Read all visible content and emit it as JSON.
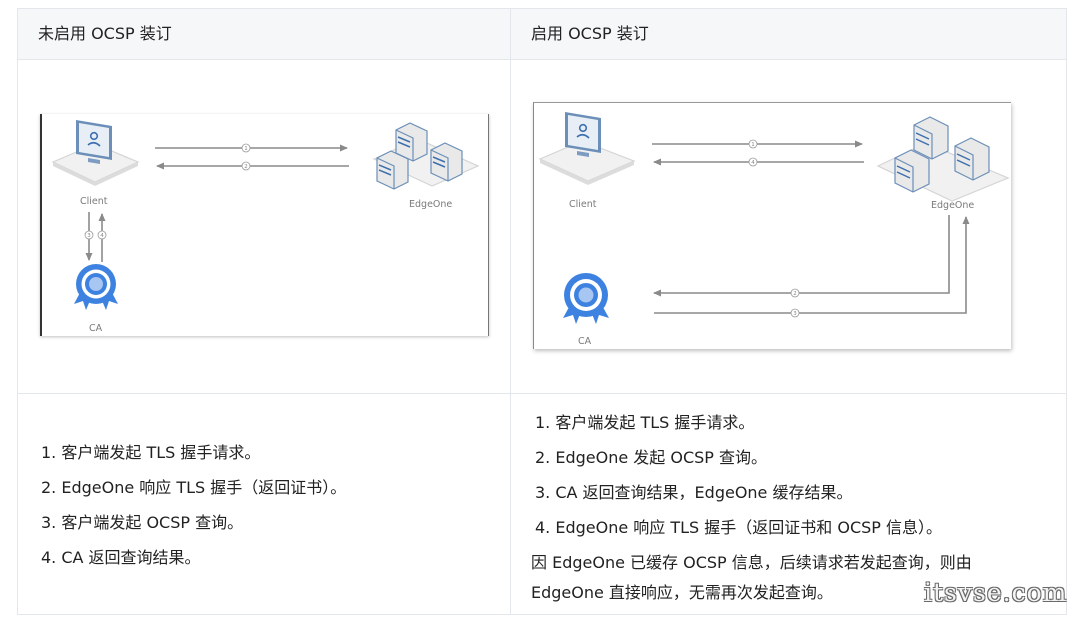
{
  "table": {
    "left_header": "未启用 OCSP 装订",
    "right_header": "启用 OCSP 装订"
  },
  "left_diagram": {
    "client_label": "Client",
    "edgeone_label": "EdgeOne",
    "ca_label": "CA",
    "arrows": [
      "1",
      "2",
      "3",
      "4"
    ]
  },
  "right_diagram": {
    "client_label": "Client",
    "edgeone_label": "EdgeOne",
    "ca_label": "CA",
    "arrows": [
      "1",
      "4",
      "2",
      "3"
    ]
  },
  "left_steps": [
    "1.  客户端发起 TLS 握手请求。",
    "2.  EdgeOne 响应 TLS 握手（返回证书）。",
    "3.  客户端发起 OCSP 查询。",
    "4.  CA 返回查询结果。"
  ],
  "right_steps": [
    "1.  客户端发起 TLS 握手请求。",
    "2.  EdgeOne 发起 OCSP 查询。",
    "3.  CA 返回查询结果，EdgeOne 缓存结果。",
    "4.  EdgeOne 响应 TLS 握手（返回证书和 OCSP 信息）。"
  ],
  "right_note_line1": "因 EdgeOne 已缓存 OCSP 信息，后续请求若发起查询，则由",
  "right_note_line2": "EdgeOne 直接响应，无需再次发起查询。",
  "watermark": "itsvse.com"
}
